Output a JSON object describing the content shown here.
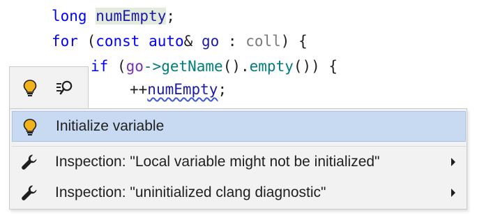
{
  "code_lines": [
    [
      {
        "t": "long ",
        "c": "kw"
      },
      {
        "t": "numEmpty",
        "c": "var hl"
      },
      {
        "t": ";",
        "c": ""
      }
    ],
    [
      {
        "t": "for ",
        "c": "kw"
      },
      {
        "t": "(",
        "c": ""
      },
      {
        "t": "const ",
        "c": "kw"
      },
      {
        "t": "auto",
        "c": "kw"
      },
      {
        "t": "& ",
        "c": ""
      },
      {
        "t": "go",
        "c": "var"
      },
      {
        "t": " : ",
        "c": ""
      },
      {
        "t": "coll",
        "c": "gray"
      },
      {
        "t": ") {",
        "c": ""
      }
    ],
    [
      {
        "t": "if ",
        "c": "kw"
      },
      {
        "t": "(",
        "c": ""
      },
      {
        "t": "go",
        "c": "purple"
      },
      {
        "t": "->",
        "c": "teal"
      },
      {
        "t": "getName",
        "c": "teal"
      },
      {
        "t": "().",
        "c": ""
      },
      {
        "t": "empty",
        "c": "teal"
      },
      {
        "t": "()) {",
        "c": ""
      }
    ],
    [
      {
        "t": "++",
        "c": ""
      },
      {
        "t": "numEmpty",
        "c": "var squiggle"
      },
      {
        "t": ";",
        "c": ""
      }
    ]
  ],
  "toolbar": {
    "buttons": [
      {
        "name": "bulb-icon"
      },
      {
        "name": "search-settings-icon"
      }
    ]
  },
  "menu": {
    "items": [
      {
        "label": "Initialize variable",
        "icon": "bulb-icon",
        "selected": true,
        "has_submenu": false
      },
      {
        "label": "Inspection: \"Local variable might not be initialized\"",
        "icon": "wrench-icon",
        "selected": false,
        "has_submenu": true
      },
      {
        "label": "Inspection: \"uninitialized clang diagnostic\"",
        "icon": "wrench-icon",
        "selected": false,
        "has_submenu": true
      }
    ]
  },
  "colors": {
    "keyword": "#0000ff",
    "selection": "#c7daf1",
    "squiggle": "#3b56d6"
  }
}
